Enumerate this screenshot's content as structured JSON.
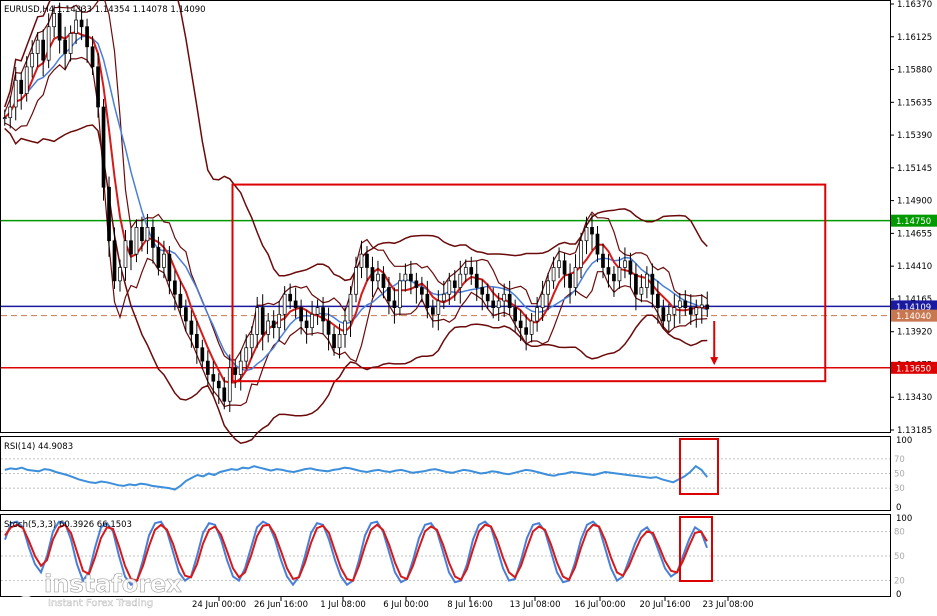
{
  "chart_data": [
    {
      "type": "candlestick",
      "title": "EURUSD,H4  1.14333 1.14354 1.14078 1.14090",
      "symbol": "EURUSD",
      "timeframe": "H4",
      "ohlc": {
        "open": 1.14333,
        "high": 1.14354,
        "low": 1.14078,
        "close": 1.1409
      },
      "price_ticks": [
        "1.16370",
        "1.16125",
        "1.15880",
        "1.15635",
        "1.15390",
        "1.15145",
        "1.14900",
        "1.14655",
        "1.14410",
        "1.14165",
        "1.13920",
        "1.13675",
        "1.13430",
        "1.13185"
      ],
      "ylim": [
        1.13185,
        1.1637
      ],
      "time_ticks": [
        "24 Jun 00:00",
        "26 Jun 16:00",
        "1 Jul 08:00",
        "6 Jul 00:00",
        "8 Jul 16:00",
        "13 Jul 08:00",
        "16 Jul 00:00",
        "20 Jul 16:00",
        "23 Jul 08:00"
      ],
      "levels": [
        {
          "label": "1.14750",
          "value": 1.1475,
          "color": "#009900"
        },
        {
          "label": "1.14109",
          "value": 1.14109,
          "color": "#1a1aa0"
        },
        {
          "label": "1.14040",
          "value": 1.1404,
          "color": "#c87850"
        },
        {
          "label": "1.13650",
          "value": 1.1365,
          "color": "#dd0000"
        }
      ],
      "box": {
        "x_start_index": 42,
        "x_end_index": 150,
        "y_top": 1.1502,
        "y_bottom": 1.1355,
        "color": "#dd0000"
      },
      "arrow": {
        "x_index": 130,
        "from": 1.14,
        "to": 1.1367,
        "color": "#dd0000"
      },
      "series": [
        {
          "name": "close",
          "values": [
            1.1552,
            1.156,
            1.158,
            1.157,
            1.159,
            1.16,
            1.161,
            1.1595,
            1.162,
            1.163,
            1.161,
            1.16,
            1.1615,
            1.1625,
            1.162,
            1.1605,
            1.159,
            1.156,
            1.15,
            1.146,
            1.143,
            1.144,
            1.146,
            1.145,
            1.147,
            1.146,
            1.147,
            1.1455,
            1.144,
            1.145,
            1.143,
            1.142,
            1.141,
            1.14,
            1.139,
            1.138,
            1.137,
            1.136,
            1.1355,
            1.135,
            1.134,
            1.1365,
            1.136,
            1.137,
            1.138,
            1.139,
            1.141,
            1.139,
            1.14,
            1.1395,
            1.1405,
            1.142,
            1.1415,
            1.141,
            1.14,
            1.1395,
            1.1405,
            1.141,
            1.14,
            1.139,
            1.138,
            1.139,
            1.14,
            1.142,
            1.144,
            1.145,
            1.144,
            1.143,
            1.1435,
            1.1425,
            1.1415,
            1.141,
            1.143,
            1.1435,
            1.143,
            1.1425,
            1.142,
            1.141,
            1.1405,
            1.1415,
            1.142,
            1.143,
            1.1425,
            1.1435,
            1.144,
            1.1435,
            1.1425,
            1.142,
            1.1415,
            1.141,
            1.1415,
            1.142,
            1.141,
            1.14,
            1.1395,
            1.139,
            1.14,
            1.141,
            1.142,
            1.143,
            1.144,
            1.1445,
            1.1435,
            1.1425,
            1.144,
            1.146,
            1.147,
            1.1465,
            1.145,
            1.144,
            1.1435,
            1.143,
            1.144,
            1.1445,
            1.1435,
            1.142,
            1.1425,
            1.1435,
            1.142,
            1.141,
            1.14,
            1.1405,
            1.141,
            1.1415,
            1.141,
            1.1405,
            1.141,
            1.1412,
            1.1409
          ]
        }
      ]
    },
    {
      "type": "line",
      "title": "RSI(14) 44.9083",
      "name": "RSI(14)",
      "value": 44.9083,
      "ylim": [
        0,
        100
      ],
      "axis_ticks": [
        "100",
        "0"
      ],
      "inner_ticks": [
        "70",
        "50",
        "30"
      ],
      "series": [
        {
          "name": "RSI(14)",
          "color": "#3d8fdb",
          "values": [
            55,
            57,
            56,
            58,
            55,
            54,
            53,
            56,
            55,
            52,
            50,
            48,
            45,
            42,
            40,
            38,
            37,
            39,
            38,
            36,
            34,
            33,
            35,
            34,
            36,
            35,
            33,
            32,
            31,
            30,
            28,
            33,
            40,
            44,
            48,
            46,
            50,
            48,
            52,
            54,
            56,
            55,
            58,
            57,
            60,
            58,
            56,
            54,
            56,
            55,
            53,
            52,
            54,
            56,
            57,
            55,
            54,
            53,
            55,
            56,
            58,
            57,
            55,
            53,
            52,
            54,
            55,
            53,
            52,
            54,
            55,
            53,
            51,
            52,
            53,
            55,
            56,
            54,
            52,
            51,
            53,
            55,
            54,
            52,
            50,
            51,
            53,
            52,
            50,
            49,
            51,
            53,
            55,
            54,
            52,
            50,
            48,
            47,
            49,
            50,
            52,
            51,
            50,
            49,
            48,
            50,
            52,
            51,
            50,
            49,
            48,
            47,
            46,
            45,
            44,
            45,
            42,
            40,
            38,
            42,
            46,
            52,
            60,
            55,
            45
          ]
        }
      ]
    },
    {
      "type": "line",
      "title": "Stoch(5,3,3) 60.3926 66.1503",
      "name": "Stoch(5,3,3)",
      "values_printed": [
        60.3926,
        66.1503
      ],
      "ylim": [
        0,
        100
      ],
      "axis_ticks": [
        "100",
        "0"
      ],
      "inner_ticks": [
        "80",
        "50",
        "20"
      ],
      "series": [
        {
          "name": "main",
          "color": "#4a7fd8",
          "values": [
            70,
            90,
            92,
            85,
            60,
            40,
            30,
            50,
            80,
            92,
            90,
            70,
            40,
            20,
            30,
            60,
            85,
            90,
            80,
            50,
            25,
            15,
            20,
            45,
            75,
            90,
            92,
            80,
            55,
            30,
            20,
            25,
            50,
            78,
            90,
            88,
            70,
            45,
            25,
            20,
            35,
            60,
            85,
            92,
            88,
            70,
            45,
            25,
            15,
            25,
            50,
            78,
            90,
            88,
            70,
            45,
            25,
            15,
            20,
            45,
            75,
            90,
            92,
            80,
            55,
            30,
            18,
            22,
            45,
            72,
            88,
            90,
            80,
            55,
            30,
            18,
            20,
            40,
            70,
            88,
            92,
            85,
            60,
            35,
            20,
            22,
            45,
            72,
            88,
            90,
            80,
            55,
            30,
            18,
            20,
            42,
            70,
            88,
            92,
            85,
            60,
            35,
            20,
            25,
            45,
            65,
            80,
            85,
            75,
            55,
            35,
            25,
            30,
            50,
            70,
            85,
            80,
            60
          ]
        },
        {
          "name": "signal",
          "color": "#d61a1a",
          "values": [
            75,
            85,
            88,
            84,
            68,
            50,
            38,
            45,
            70,
            85,
            88,
            78,
            55,
            32,
            28,
            48,
            72,
            85,
            83,
            62,
            38,
            22,
            20,
            38,
            62,
            82,
            88,
            82,
            65,
            42,
            26,
            24,
            40,
            65,
            82,
            86,
            76,
            56,
            35,
            24,
            30,
            50,
            74,
            87,
            88,
            76,
            56,
            35,
            22,
            24,
            42,
            66,
            84,
            87,
            78,
            56,
            35,
            22,
            20,
            38,
            62,
            82,
            88,
            82,
            64,
            42,
            25,
            22,
            38,
            60,
            80,
            86,
            82,
            64,
            42,
            25,
            21,
            34,
            58,
            80,
            88,
            86,
            70,
            48,
            30,
            24,
            38,
            60,
            80,
            86,
            82,
            64,
            42,
            25,
            21,
            36,
            60,
            80,
            88,
            86,
            70,
            48,
            30,
            26,
            38,
            56,
            72,
            80,
            78,
            62,
            44,
            32,
            30,
            44,
            62,
            78,
            80,
            68
          ]
        }
      ]
    }
  ],
  "watermark": {
    "brand": "instaforex",
    "tagline": "Instant Forex Trading"
  }
}
